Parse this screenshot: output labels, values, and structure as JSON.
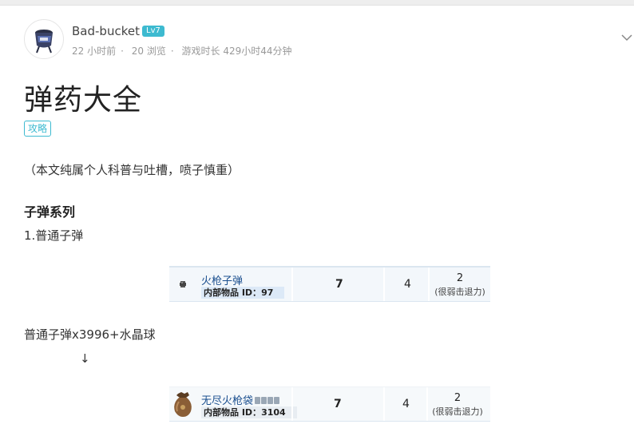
{
  "author": {
    "name": "Bad-bucket",
    "level": "Lv7"
  },
  "meta": {
    "time_ago": "22 小时前",
    "views": "20 浏览",
    "playtime": "游戏时长 429小时44分钟"
  },
  "post": {
    "title": "弹药大全",
    "tag": "攻略",
    "intro": "（本文纯属个人科普与吐槽，喷子慎重）",
    "section_heading": "子弹系列",
    "item1_heading": "1.普通子弹",
    "recipe": "普通子弹x3996+水晶球",
    "arrow": "↓"
  },
  "items": [
    {
      "name": "火枪子弹",
      "id_label": "内部物品 ID：",
      "id": "97",
      "damage": "7",
      "velocity": "4",
      "knockback": "2",
      "knockback_desc": "(很弱击退力)"
    },
    {
      "name": "无尽火枪袋",
      "id_label": "内部物品 ID：",
      "id": "3104",
      "damage": "7",
      "velocity": "4",
      "knockback": "2",
      "knockback_desc": "(很弱击退力)"
    }
  ],
  "colors": {
    "accent": "#3dbad0",
    "link": "#1b4f8f"
  }
}
